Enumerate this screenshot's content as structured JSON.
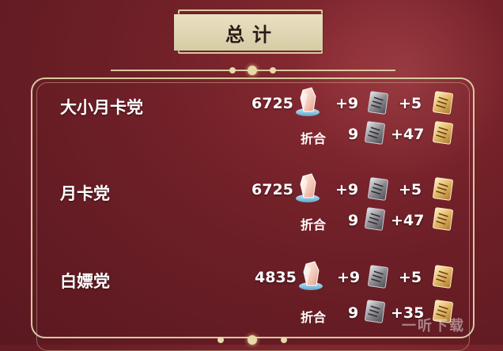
{
  "header": {
    "title": "总计"
  },
  "groups": [
    {
      "label": "大小月卡党",
      "crystals": "6725",
      "silver_pass": "+9",
      "gold_pass": "+5",
      "fold_label": "折合",
      "fold_silver": "9",
      "fold_gold": "+47"
    },
    {
      "label": "月卡党",
      "crystals": "6725",
      "silver_pass": "+9",
      "gold_pass": "+5",
      "fold_label": "折合",
      "fold_silver": "9",
      "fold_gold": "+47"
    },
    {
      "label": "白嫖党",
      "crystals": "4835",
      "silver_pass": "+9",
      "gold_pass": "+5",
      "fold_label": "折合",
      "fold_silver": "9",
      "fold_gold": "+35"
    }
  ],
  "watermark": "一听下载",
  "icons": {
    "crystal": "crystal-icon",
    "silver_pass": "silver-pass-icon",
    "gold_pass": "gold-pass-icon"
  },
  "colors": {
    "background": "#6e1f27",
    "frame": "#d9c9a0",
    "plate": "#e3d9b7",
    "text": "#ffffff"
  }
}
